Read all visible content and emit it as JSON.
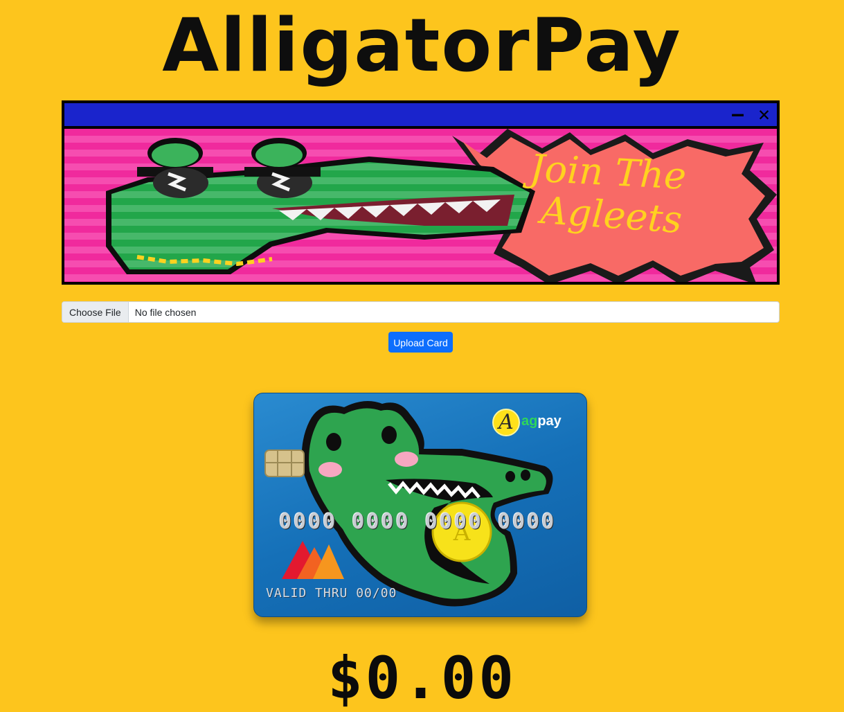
{
  "app": {
    "title": "AlligatorPay"
  },
  "banner": {
    "text_line1": "Join The",
    "text_line2": "Agleets",
    "minimize_icon": "minus",
    "close_icon": "close"
  },
  "upload": {
    "choose_file_label": "Choose File",
    "file_status": "No file chosen",
    "upload_button_label": "Upload Card"
  },
  "card": {
    "brand_initial": "A",
    "brand_ag": "ag",
    "brand_pay": "pay",
    "number": "0000 0000 0000 0000",
    "valid_thru": "VALID THRU 00/00"
  },
  "balance": {
    "amount": "$0.00"
  }
}
